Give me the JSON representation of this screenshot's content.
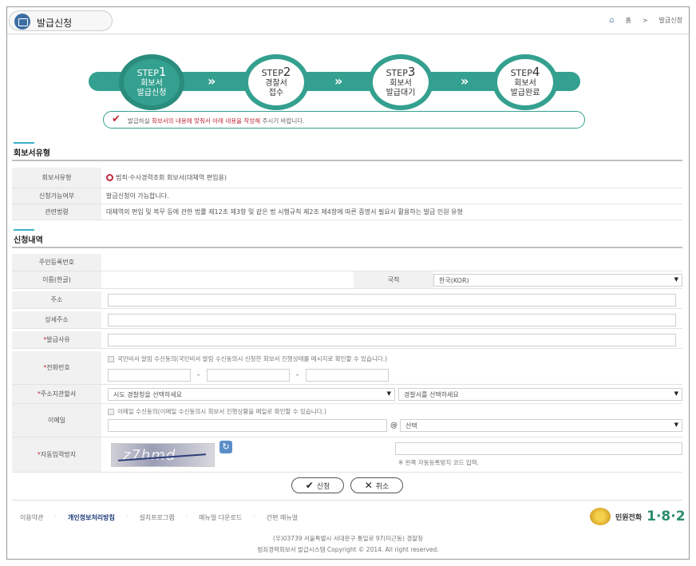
{
  "header": {
    "title": "발급신청",
    "breadcrumb": [
      "홈",
      ">",
      "발급신청"
    ]
  },
  "steps": [
    {
      "num": "1",
      "prefix": "STEP",
      "label": "회보서\n발급신청",
      "active": true
    },
    {
      "num": "2",
      "prefix": "STEP",
      "label": "경찰서\n접수",
      "active": false
    },
    {
      "num": "3",
      "prefix": "STEP",
      "label": "회보서\n발급대기",
      "active": false
    },
    {
      "num": "4",
      "prefix": "STEP",
      "label": "회보서\n발급완료",
      "active": false
    }
  ],
  "guide": {
    "pre": "발급하실 ",
    "highlight": "회보서의 내용에 맞춰서 아래 내용을 작성해",
    "post": " 주시기 바랍니다."
  },
  "section1": {
    "title": "회보서유형",
    "rows": [
      {
        "label": "회보서유형",
        "value": "범죄·수사경력조회 회보서(대체역 편입용)"
      },
      {
        "label": "신청가능여부",
        "value": "발급신청이 가능합니다."
      },
      {
        "label": "관련법령",
        "value": "대체역의 편입 및 복무 등에 관한 법률 제12조 제3항 및 같은 법 시행규칙 제2조 제4항에 따른 증명서 필요시 활용하는 발급 민원 유형"
      }
    ]
  },
  "section2": {
    "title": "신청내역",
    "labels": {
      "rrn": "주민등록번호",
      "name": "이름(한글)",
      "nationality": "국적",
      "address": "주소",
      "address_detail": "상세주소",
      "reason": "발급사유",
      "phone": "전화번호",
      "police": "주소지관할서",
      "email": "이메일",
      "captcha": "자동입력방지"
    },
    "nationality_value": "한국(KOR)",
    "phone_consent": "국민비서 알림 수신동의(국민비서 알림 수신동의시 신청한 회보서 진행상태를 메시지로 확인할 수 있습니다.)",
    "phone_sep": "-",
    "police_province": "시도 경찰청을 선택하세요",
    "police_station": "경찰서를 선택하세요",
    "email_consent": "이메일 수신동의(이메일 수신동의시 회보서 진행상황을 메일로 확인할 수 있습니다.)",
    "email_at": "@",
    "email_domain": "선택",
    "captcha_text": "z7hmd",
    "captcha_hint": "※ 왼쪽 자동등록방지 코드 입력."
  },
  "buttons": {
    "submit": "신청",
    "cancel": "취소"
  },
  "footer": {
    "links": [
      "이용약관",
      "개인정보처리방침",
      "설치프로그램",
      "매뉴얼 다운로드",
      "간편 매뉴얼"
    ],
    "tel_label": "민원전화",
    "tel_number": "1·8·2",
    "address": "(우)03739 서울특별시 서대문구 통일로 97(미근동) 경찰청",
    "copyright": "범죄경력회보서 발급시스템 Copyright © 2014. All right reserved."
  }
}
